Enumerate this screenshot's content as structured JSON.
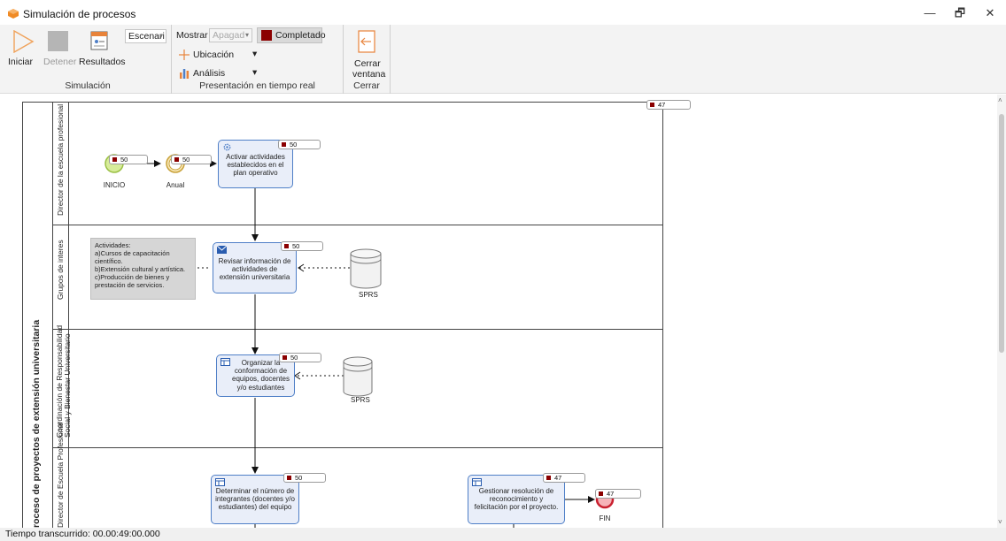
{
  "window": {
    "title": "Simulación de procesos",
    "minimize": "—",
    "restore": "🗗",
    "close": "✕"
  },
  "ribbon": {
    "simulation": {
      "start_label": "Iniciar",
      "stop_label": "Detener",
      "results_label": "Resultados",
      "scenario_value": "Escenari",
      "group_label": "Simulación"
    },
    "presentation": {
      "show_label": "Mostrar",
      "show_value": "Apagad",
      "completed_label": "Completado",
      "location_label": "Ubicación",
      "analysis_label": "Análisis",
      "group_label": "Presentación en tiempo real"
    },
    "close": {
      "close_window_line1": "Cerrar",
      "close_window_line2": "ventana",
      "group_label": "Cerrar"
    }
  },
  "diagram": {
    "pool_label": "Proceso de proyectos de extensión universitaria",
    "pool_counter": "47",
    "lanes": [
      {
        "label": "Director de la escuela profesional"
      },
      {
        "label": "Grupos de interes"
      },
      {
        "label_line1": "Coordinación de Responsabilidad",
        "label_line2": "Social y Bienestar Universitario"
      },
      {
        "label": "Director de Escuela Profesional"
      }
    ],
    "events": {
      "start_label": "INICIO",
      "start_counter": "50",
      "timer_label": "Anual",
      "timer_counter": "50",
      "end_label": "FIN",
      "end_counter": "47"
    },
    "tasks": [
      {
        "text": "Activar actividades establecidos en el plan operativo",
        "counter": "50"
      },
      {
        "text": "Revisar información de actividades de extensión universitaria",
        "counter": "50"
      },
      {
        "text": "Organizar la conformación de equipos, docentes y/o estudiantes",
        "counter": "50"
      },
      {
        "text": "Determinar el número de integrantes (docentes y/o estudiantes) del equipo",
        "counter": "50"
      },
      {
        "text": "Gestionar resolución de reconocimiento y felicitación por el proyecto.",
        "counter": "47"
      }
    ],
    "annotation": "Actividades:\na)Cursos de capacitación científico.\nb)Extensión cultural y artística.\nc)Producción de bienes y prestación de servicios.",
    "datastores": [
      "SPRS",
      "SPRS"
    ]
  },
  "status": {
    "elapsed": "Tiempo transcurrido:  00.00:49:00.000"
  }
}
